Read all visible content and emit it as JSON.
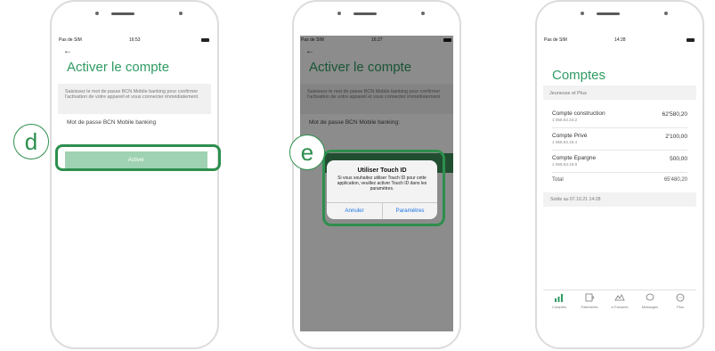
{
  "phone1": {
    "status": {
      "carrier": "Pas de SIM",
      "time": "16:53"
    },
    "back_glyph": "←",
    "title": "Activer le compte",
    "description": "Saisissez le mot de passe BCN Mobile banking pour confirmer l'activation de votre appareil et vous connecter immédiatement.",
    "password_label": "Mot de passe BCN Mobile banking",
    "activate_button": "Activer",
    "step_label": "d"
  },
  "phone2": {
    "status": {
      "carrier": "Pas de SIM",
      "time": "16:27"
    },
    "back_glyph": "←",
    "title": "Activer le compte",
    "description": "Saisissez le mot de passe BCN Mobile banking pour confirmer l'activation de votre appareil et vous connecter immédiatement.",
    "password_label": "Mot de passe BCN Mobile banking:",
    "alert": {
      "title": "Utiliser Touch ID",
      "message": "Si vous souhaitez utiliser Touch ID pour cette application, veuillez activer Touch ID dans les paramètres.",
      "cancel": "Annuler",
      "settings": "Paramètres"
    },
    "step_label": "e"
  },
  "phone3": {
    "status": {
      "carrier": "Pas de SIM",
      "time": "14:28"
    },
    "title": "Comptes",
    "section": "Jeunesse et Plus",
    "accounts": [
      {
        "name": "Compte construction",
        "number": "1 058.63.34.2",
        "amount": "62'580,20"
      },
      {
        "name": "Compte Privé",
        "number": "1 058.63.18.4",
        "amount": "2'100,00"
      },
      {
        "name": "Compte Epargne",
        "number": "1 058.63.19.9",
        "amount": "500,00"
      }
    ],
    "total_label": "Total",
    "total_amount": "65'480,20",
    "balance_note": "Solde au 07.10.21 14:28",
    "tabs": [
      {
        "icon": "bar-chart-icon",
        "label": "Comptes"
      },
      {
        "icon": "transfer-icon",
        "label": "Paiements"
      },
      {
        "icon": "cards-icon",
        "label": "e-Factures"
      },
      {
        "icon": "chat-icon",
        "label": "Messages"
      },
      {
        "icon": "more-icon",
        "label": "Plus"
      }
    ]
  },
  "colors": {
    "brand_green": "#2f9b63",
    "callout_green": "#2d8f4e",
    "button_light_green": "#9fd2b2",
    "link_blue": "#1a73e8"
  }
}
